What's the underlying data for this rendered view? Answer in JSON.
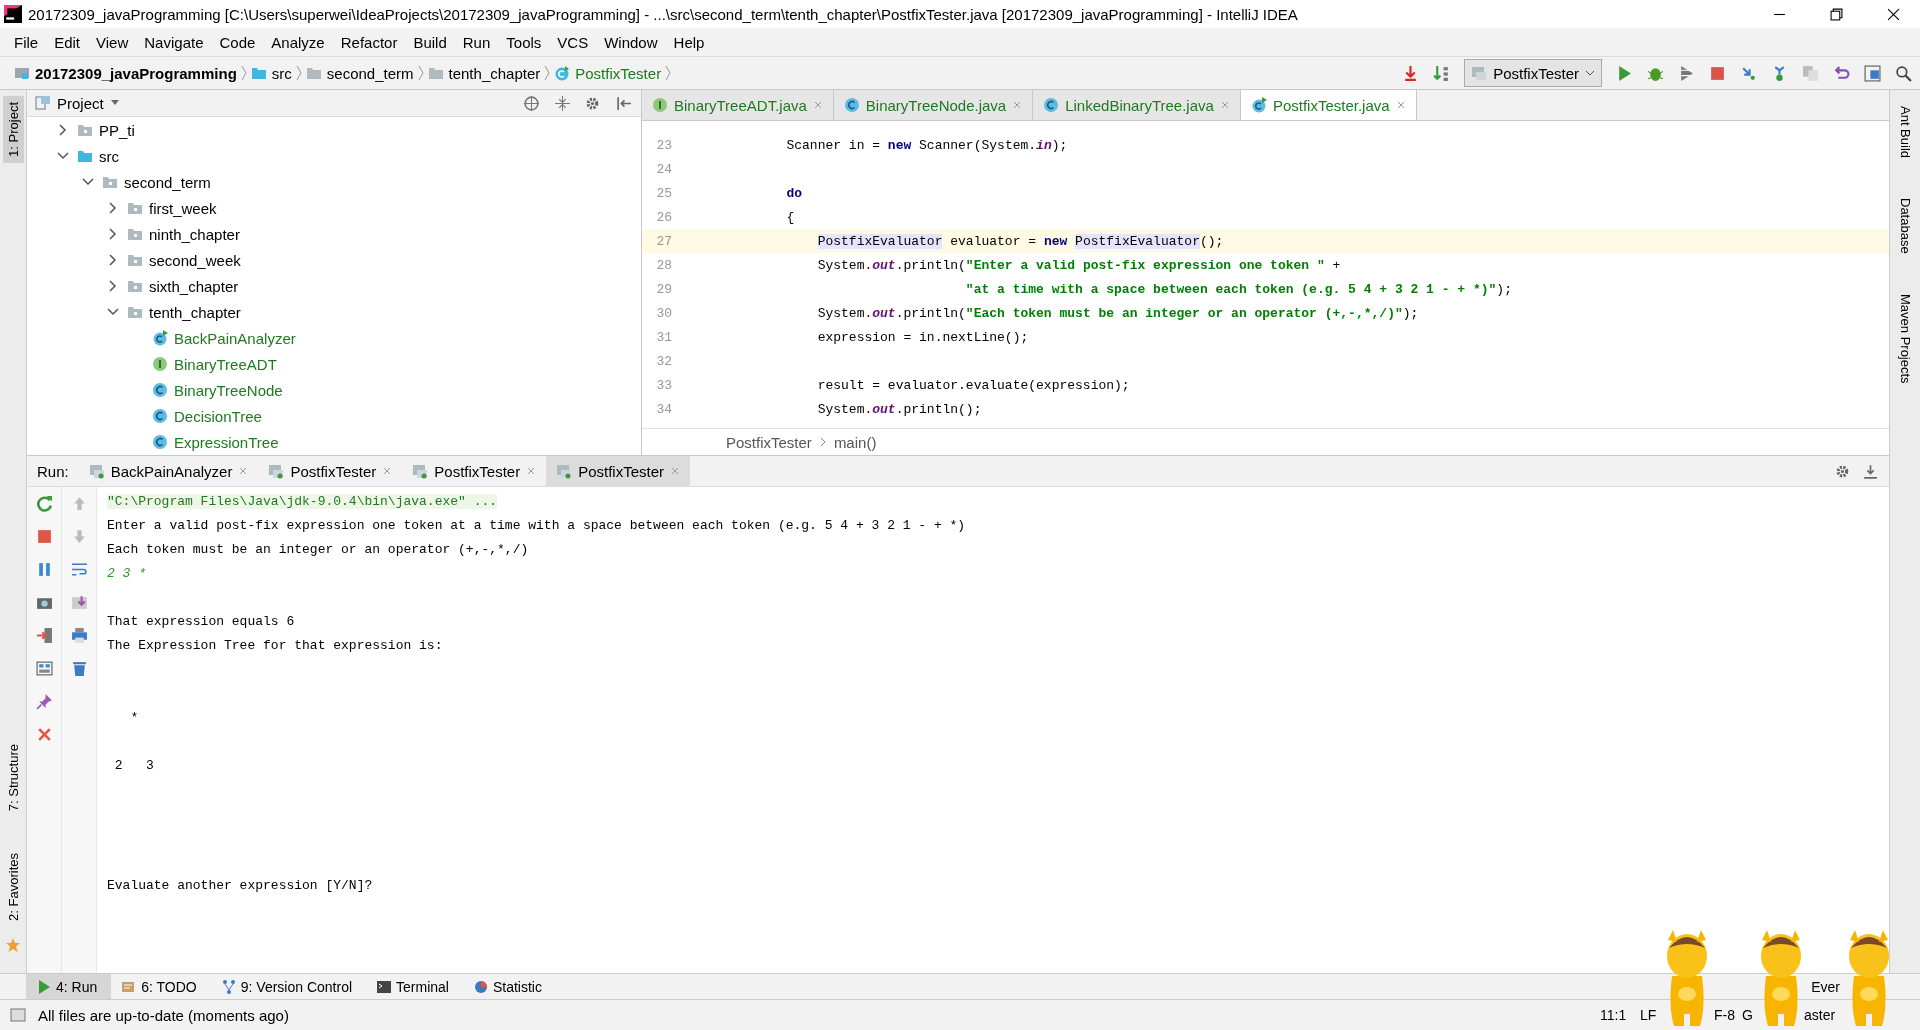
{
  "window": {
    "title": "20172309_javaProgramming [C:\\Users\\superwei\\IdeaProjects\\20172309_javaProgramming] - ...\\src\\second_term\\tenth_chapter\\PostfixTester.java [20172309_javaProgramming] - IntelliJ IDEA"
  },
  "menu": [
    "File",
    "Edit",
    "View",
    "Navigate",
    "Code",
    "Analyze",
    "Refactor",
    "Build",
    "Run",
    "Tools",
    "VCS",
    "Window",
    "Help"
  ],
  "navbar": {
    "crumbs": [
      {
        "label": "20172309_javaProgramming",
        "kind": "project"
      },
      {
        "label": "src",
        "kind": "source_root"
      },
      {
        "label": "second_term",
        "kind": "folder"
      },
      {
        "label": "tenth_chapter",
        "kind": "folder"
      },
      {
        "label": "PostfixTester",
        "kind": "main_class"
      }
    ],
    "run_config": "PostfixTester"
  },
  "left_strip": [
    {
      "label": "1: Project",
      "selected": true
    },
    {
      "label": "7: Structure",
      "selected": false
    },
    {
      "label": "2: Favorites",
      "selected": false
    }
  ],
  "right_strip": [
    "Ant Build",
    "Database",
    "Maven Projects"
  ],
  "project_panel": {
    "title": "Project",
    "tree": [
      {
        "label": "PP_ti",
        "kind": "folder",
        "expanded": false
      },
      {
        "label": "src",
        "kind": "source_root",
        "expanded": true,
        "children": [
          {
            "label": "second_term",
            "kind": "folder",
            "expanded": true,
            "children": [
              {
                "label": "first_week",
                "kind": "folder",
                "expanded": false
              },
              {
                "label": "ninth_chapter",
                "kind": "folder",
                "expanded": false
              },
              {
                "label": "second_week",
                "kind": "folder",
                "expanded": false
              },
              {
                "label": "sixth_chapter",
                "kind": "folder",
                "expanded": false
              },
              {
                "label": "tenth_chapter",
                "kind": "folder",
                "expanded": true,
                "children": [
                  {
                    "label": "BackPainAnalyzer",
                    "kind": "main_class"
                  },
                  {
                    "label": "BinaryTreeADT",
                    "kind": "interface"
                  },
                  {
                    "label": "BinaryTreeNode",
                    "kind": "class"
                  },
                  {
                    "label": "DecisionTree",
                    "kind": "class"
                  },
                  {
                    "label": "ExpressionTree",
                    "kind": "class"
                  }
                ]
              }
            ]
          }
        ]
      }
    ]
  },
  "editor": {
    "tabs": [
      {
        "label": "BinaryTreeADT.java",
        "kind": "interface",
        "selected": false
      },
      {
        "label": "BinaryTreeNode.java",
        "kind": "class",
        "selected": false
      },
      {
        "label": "LinkedBinaryTree.java",
        "kind": "class",
        "selected": false
      },
      {
        "label": "PostfixTester.java",
        "kind": "main_class",
        "selected": true
      }
    ],
    "lines": [
      {
        "number": "23",
        "current": false,
        "segments": [
          {
            "kind": "plain",
            "text": "        Scanner in = "
          },
          {
            "kind": "keyword",
            "text": "new"
          },
          {
            "kind": "plain",
            "text": " Scanner(System."
          },
          {
            "kind": "field",
            "text": "in"
          },
          {
            "kind": "plain",
            "text": ");"
          }
        ]
      },
      {
        "number": "24",
        "current": false
      },
      {
        "number": "25",
        "current": false,
        "segments": [
          {
            "kind": "keyword",
            "text": "        do"
          }
        ]
      },
      {
        "number": "26",
        "current": false,
        "segments": [
          {
            "kind": "plain",
            "text": "        {"
          }
        ]
      },
      {
        "number": "27",
        "current": true,
        "segments": [
          {
            "kind": "usage",
            "text": "            PostfixEvaluator"
          },
          {
            "kind": "plain",
            "text": " evaluator = "
          },
          {
            "kind": "keyword",
            "text": "new"
          },
          {
            "kind": "usage",
            "text": " PostfixEvaluator"
          },
          {
            "kind": "plain",
            "text": "();"
          }
        ]
      },
      {
        "number": "28",
        "current": false,
        "segments": [
          {
            "kind": "plain",
            "text": "            System."
          },
          {
            "kind": "field",
            "text": "out"
          },
          {
            "kind": "plain",
            "text": ".println("
          },
          {
            "kind": "string",
            "text": "\"Enter a valid post-fix expression one token \""
          },
          {
            "kind": "plain",
            "text": " +"
          }
        ]
      },
      {
        "number": "29",
        "current": false,
        "segments": [
          {
            "kind": "string",
            "text": "                               \"at a time with a space between each token (e.g. 5 4 + 3 2 1 - + *)\""
          },
          {
            "kind": "plain",
            "text": ");"
          }
        ]
      },
      {
        "number": "30",
        "current": false,
        "segments": [
          {
            "kind": "plain",
            "text": "            System."
          },
          {
            "kind": "field",
            "text": "out"
          },
          {
            "kind": "plain",
            "text": ".println("
          },
          {
            "kind": "string",
            "text": "\"Each token must be an integer or an operator (+,-,*,/)\""
          },
          {
            "kind": "plain",
            "text": ");"
          }
        ]
      },
      {
        "number": "31",
        "current": false,
        "segments": [
          {
            "kind": "plain",
            "text": "            expression = in.nextLine();"
          }
        ]
      },
      {
        "number": "32",
        "current": false
      },
      {
        "number": "33",
        "current": false,
        "segments": [
          {
            "kind": "plain",
            "text": "            result = evaluator.evaluate(expression);"
          }
        ]
      },
      {
        "number": "34",
        "current": false,
        "segments": [
          {
            "kind": "plain",
            "text": "            System."
          },
          {
            "kind": "field",
            "text": "out"
          },
          {
            "kind": "plain",
            "text": ".println();"
          }
        ]
      }
    ],
    "breadcrumb": [
      "PostfixTester",
      "main()"
    ]
  },
  "run_panel": {
    "label": "Run:",
    "tabs": [
      {
        "label": "BackPainAnalyzer",
        "selected": false
      },
      {
        "label": "PostfixTester",
        "selected": false
      },
      {
        "label": "PostfixTester",
        "selected": false
      },
      {
        "label": "PostfixTester",
        "selected": true
      }
    ],
    "console": [
      {
        "kind": "command",
        "text": "\"C:\\Program Files\\Java\\jdk-9.0.4\\bin\\java.exe\" ..."
      },
      {
        "kind": "output",
        "text": "Enter a valid post-fix expression one token at a time with a space between each token (e.g. 5 4 + 3 2 1 - + *)"
      },
      {
        "kind": "output",
        "text": "Each token must be an integer or an operator (+,-,*,/)"
      },
      {
        "kind": "input",
        "text": "2 3 *"
      },
      {
        "kind": "blank"
      },
      {
        "kind": "output",
        "text": "That expression equals 6"
      },
      {
        "kind": "output",
        "text": "The Expression Tree for that expression is:"
      },
      {
        "kind": "blank"
      },
      {
        "kind": "blank"
      },
      {
        "kind": "output",
        "text": "   *"
      },
      {
        "kind": "blank"
      },
      {
        "kind": "output",
        "text": " 2   3"
      },
      {
        "kind": "blank"
      },
      {
        "kind": "blank"
      },
      {
        "kind": "blank"
      },
      {
        "kind": "blank"
      },
      {
        "kind": "output",
        "text": "Evaluate another expression [Y/N]?"
      }
    ]
  },
  "tool_windows": [
    {
      "label": "4: Run",
      "kind": "run",
      "selected": true
    },
    {
      "label": "6: TODO",
      "kind": "todo",
      "selected": false
    },
    {
      "label": "9: Version Control",
      "kind": "vcs",
      "selected": false
    },
    {
      "label": "Terminal",
      "kind": "terminal",
      "selected": false
    },
    {
      "label": "Statistic",
      "kind": "statistic",
      "selected": false
    }
  ],
  "event_log": "Ever",
  "status_bar": {
    "message": "All files are up-to-date (moments ago)",
    "position": "11:1",
    "line_separator": "LF",
    "encoding": "F-8",
    "vcs_prefix": "G",
    "vcs_branch": "aster"
  }
}
